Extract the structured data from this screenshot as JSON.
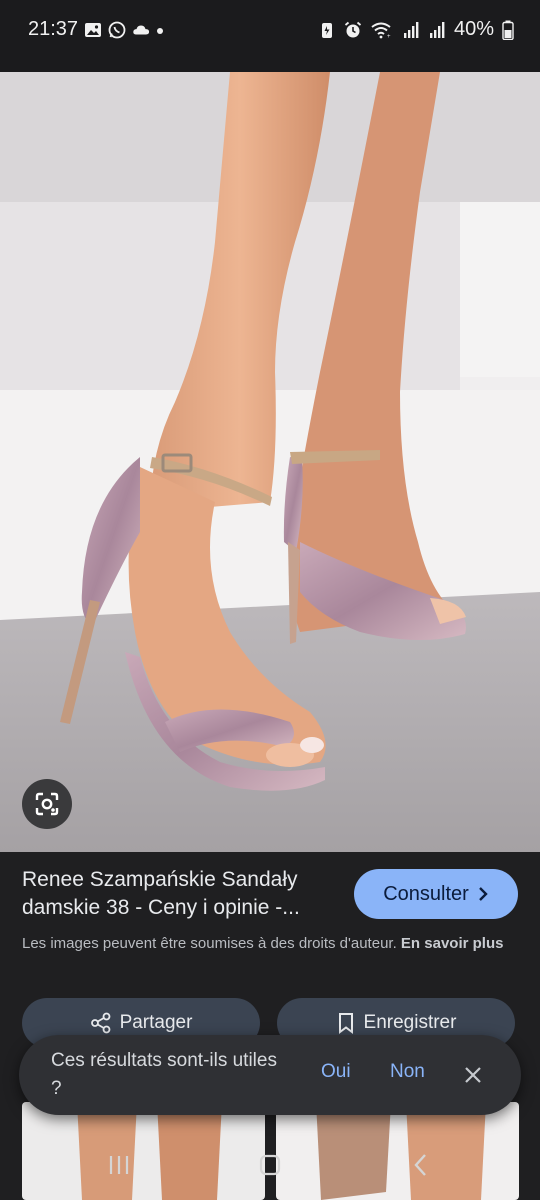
{
  "status_bar": {
    "time": "21:37",
    "battery": "40%",
    "left_icons": [
      "gallery-icon",
      "whatsapp-icon",
      "cloud-icon",
      "dot-icon"
    ],
    "right_icons": [
      "battery-saver-icon",
      "alarm-icon",
      "wifi-icon",
      "signal-icon",
      "signal-icon",
      "battery-icon"
    ]
  },
  "result": {
    "title": "Renee Szampańskie Sandały damskie 38 - Ceny i opinie -...",
    "visit_label": "Consulter",
    "copyright_text": "Les images peuvent être soumises à des droits d'auteur.",
    "learn_more": "En savoir plus"
  },
  "actions": {
    "share_label": "Partager",
    "save_label": "Enregistrer"
  },
  "feedback": {
    "question": "Ces résultats sont-ils utiles ?",
    "yes": "Oui",
    "no": "Non"
  },
  "colors": {
    "accent": "#8ab4f8",
    "background": "#1f1f21",
    "button_bg": "#3b4452"
  }
}
